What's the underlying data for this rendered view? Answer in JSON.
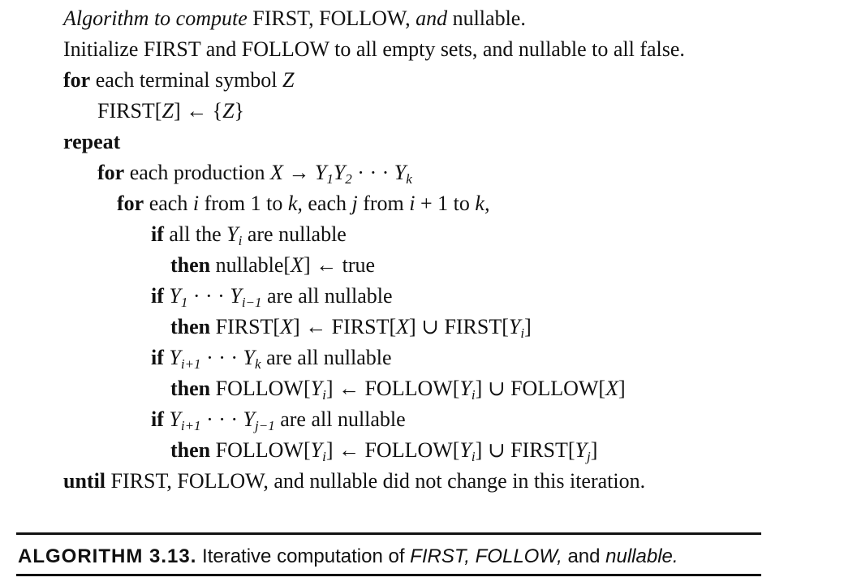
{
  "algorithm": {
    "title": {
      "prefix": "Algorithm to compute",
      "first": "FIRST,",
      "follow": "FOLLOW,",
      "and": "and",
      "nullable": "nullable."
    },
    "init": "Initialize FIRST and FOLLOW to all empty sets, and nullable to all false.",
    "loop1": {
      "keyword": "for",
      "text": "each terminal symbol",
      "var": "Z"
    },
    "first_z": {
      "lhs": "FIRST[",
      "var": "Z",
      "mid": "] ← {",
      "var2": "Z",
      "end": "}"
    },
    "repeat": "repeat",
    "loop2": {
      "keyword": "for",
      "text": "each production",
      "X": "X",
      "arrow": "→",
      "Y": "Y",
      "s1": "1",
      "s2": "2",
      "dots": "· · ·",
      "sk": "k"
    },
    "loop3": {
      "keyword": "for",
      "text1": "each",
      "i": "i",
      "text2": "from 1 to",
      "k": "k,",
      "text3": "each",
      "j": "j",
      "text4": "from",
      "i2": "i",
      "text5": "+ 1 to",
      "k2": "k,"
    },
    "if1": {
      "keyword": "if",
      "text1": "all the",
      "Y": "Y",
      "sub": "i",
      "text2": "are nullable"
    },
    "then1": {
      "keyword": "then",
      "text1": "nullable[",
      "X": "X",
      "text2": "] ← true"
    },
    "if2": {
      "keyword": "if",
      "Y1": "Y",
      "s1": "1",
      "dots": "· · ·",
      "Y2": "Y",
      "s2": "i−1",
      "text": "are all nullable"
    },
    "then2": {
      "keyword": "then",
      "t1": "FIRST[",
      "X1": "X",
      "t2": "] ← FIRST[",
      "X2": "X",
      "t3": "] ∪ FIRST[",
      "Y": "Y",
      "s": "i",
      "t4": "]"
    },
    "if3": {
      "keyword": "if",
      "Y1": "Y",
      "s1": "i+1",
      "dots": "· · ·",
      "Y2": "Y",
      "s2": "k",
      "text": "are all nullable"
    },
    "then3": {
      "keyword": "then",
      "t1": "FOLLOW[",
      "Y1": "Y",
      "s1": "i",
      "t2": "] ← FOLLOW[",
      "Y2": "Y",
      "s2": "i",
      "t3": "] ∪ FOLLOW[",
      "X": "X",
      "t4": "]"
    },
    "if4": {
      "keyword": "if",
      "Y1": "Y",
      "s1": "i+1",
      "dots": "· · ·",
      "Y2": "Y",
      "s2": "j−1",
      "text": "are all nullable"
    },
    "then4": {
      "keyword": "then",
      "t1": "FOLLOW[",
      "Y1": "Y",
      "s1": "i",
      "t2": "] ← FOLLOW[",
      "Y2": "Y",
      "s2": "i",
      "t3": "] ∪ FIRST[",
      "Y3": "Y",
      "s3": "j",
      "t4": "]"
    },
    "until": {
      "keyword": "until",
      "text": "FIRST, FOLLOW, and nullable did not change in this iteration."
    }
  },
  "caption": {
    "label": "ALGORITHM 3.13.",
    "text1": "Iterative computation of",
    "first": "FIRST,",
    "follow": "FOLLOW,",
    "and": "and",
    "nullable": "nullable."
  }
}
